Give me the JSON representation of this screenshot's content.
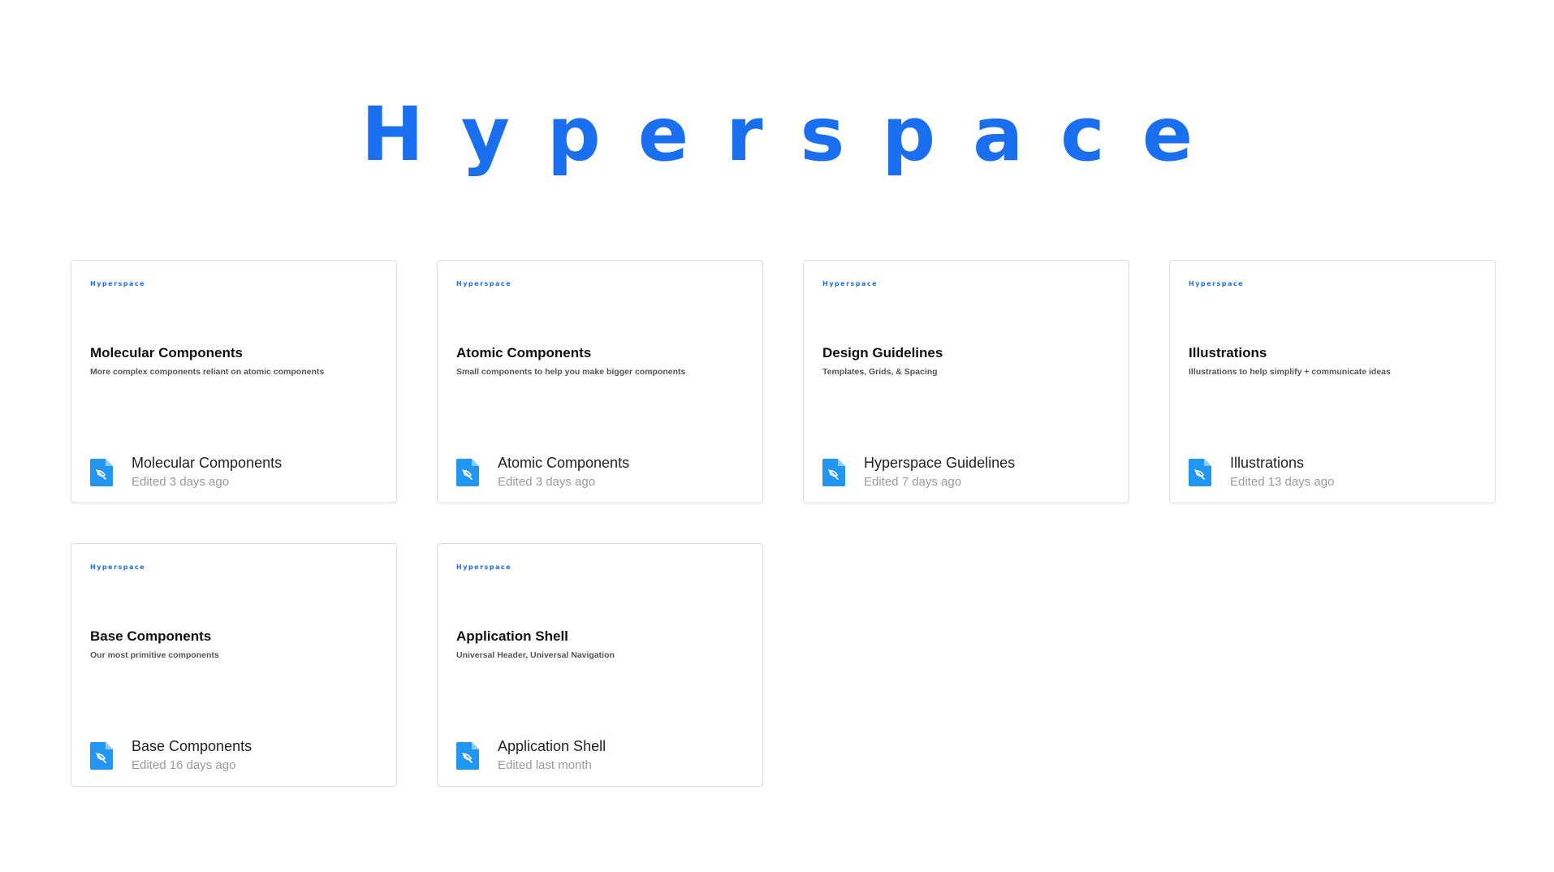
{
  "header": {
    "logo_text": "Hyperspace"
  },
  "colors": {
    "brand": "#1a6ef0",
    "file_icon": "#2196f3",
    "card_border": "#dcdcdc"
  },
  "cards": [
    {
      "brand": "Hyperspace",
      "title": "Molecular Components",
      "description": "More complex components reliant on atomic components",
      "file_name": "Molecular Components",
      "edited": "Edited 3 days ago",
      "icon": "figma-file-icon"
    },
    {
      "brand": "Hyperspace",
      "title": "Atomic Components",
      "description": "Small components to help you make bigger components",
      "file_name": "Atomic Components",
      "edited": "Edited 3 days ago",
      "icon": "figma-file-icon"
    },
    {
      "brand": "Hyperspace",
      "title": "Design Guidelines",
      "description": "Templates, Grids, & Spacing",
      "file_name": "Hyperspace Guidelines",
      "edited": "Edited 7 days ago",
      "icon": "figma-file-icon"
    },
    {
      "brand": "Hyperspace",
      "title": "Illustrations",
      "description": "Illustrations to help simplify + communicate ideas",
      "file_name": "Illustrations",
      "edited": "Edited 13 days ago",
      "icon": "figma-file-icon"
    },
    {
      "brand": "Hyperspace",
      "title": "Base Components",
      "description": "Our most primitive components",
      "file_name": "Base Components",
      "edited": "Edited 16 days ago",
      "icon": "figma-file-icon"
    },
    {
      "brand": "Hyperspace",
      "title": "Application Shell",
      "description": "Universal Header, Universal Navigation",
      "file_name": "Application Shell",
      "edited": "Edited last month",
      "icon": "figma-file-icon"
    }
  ]
}
